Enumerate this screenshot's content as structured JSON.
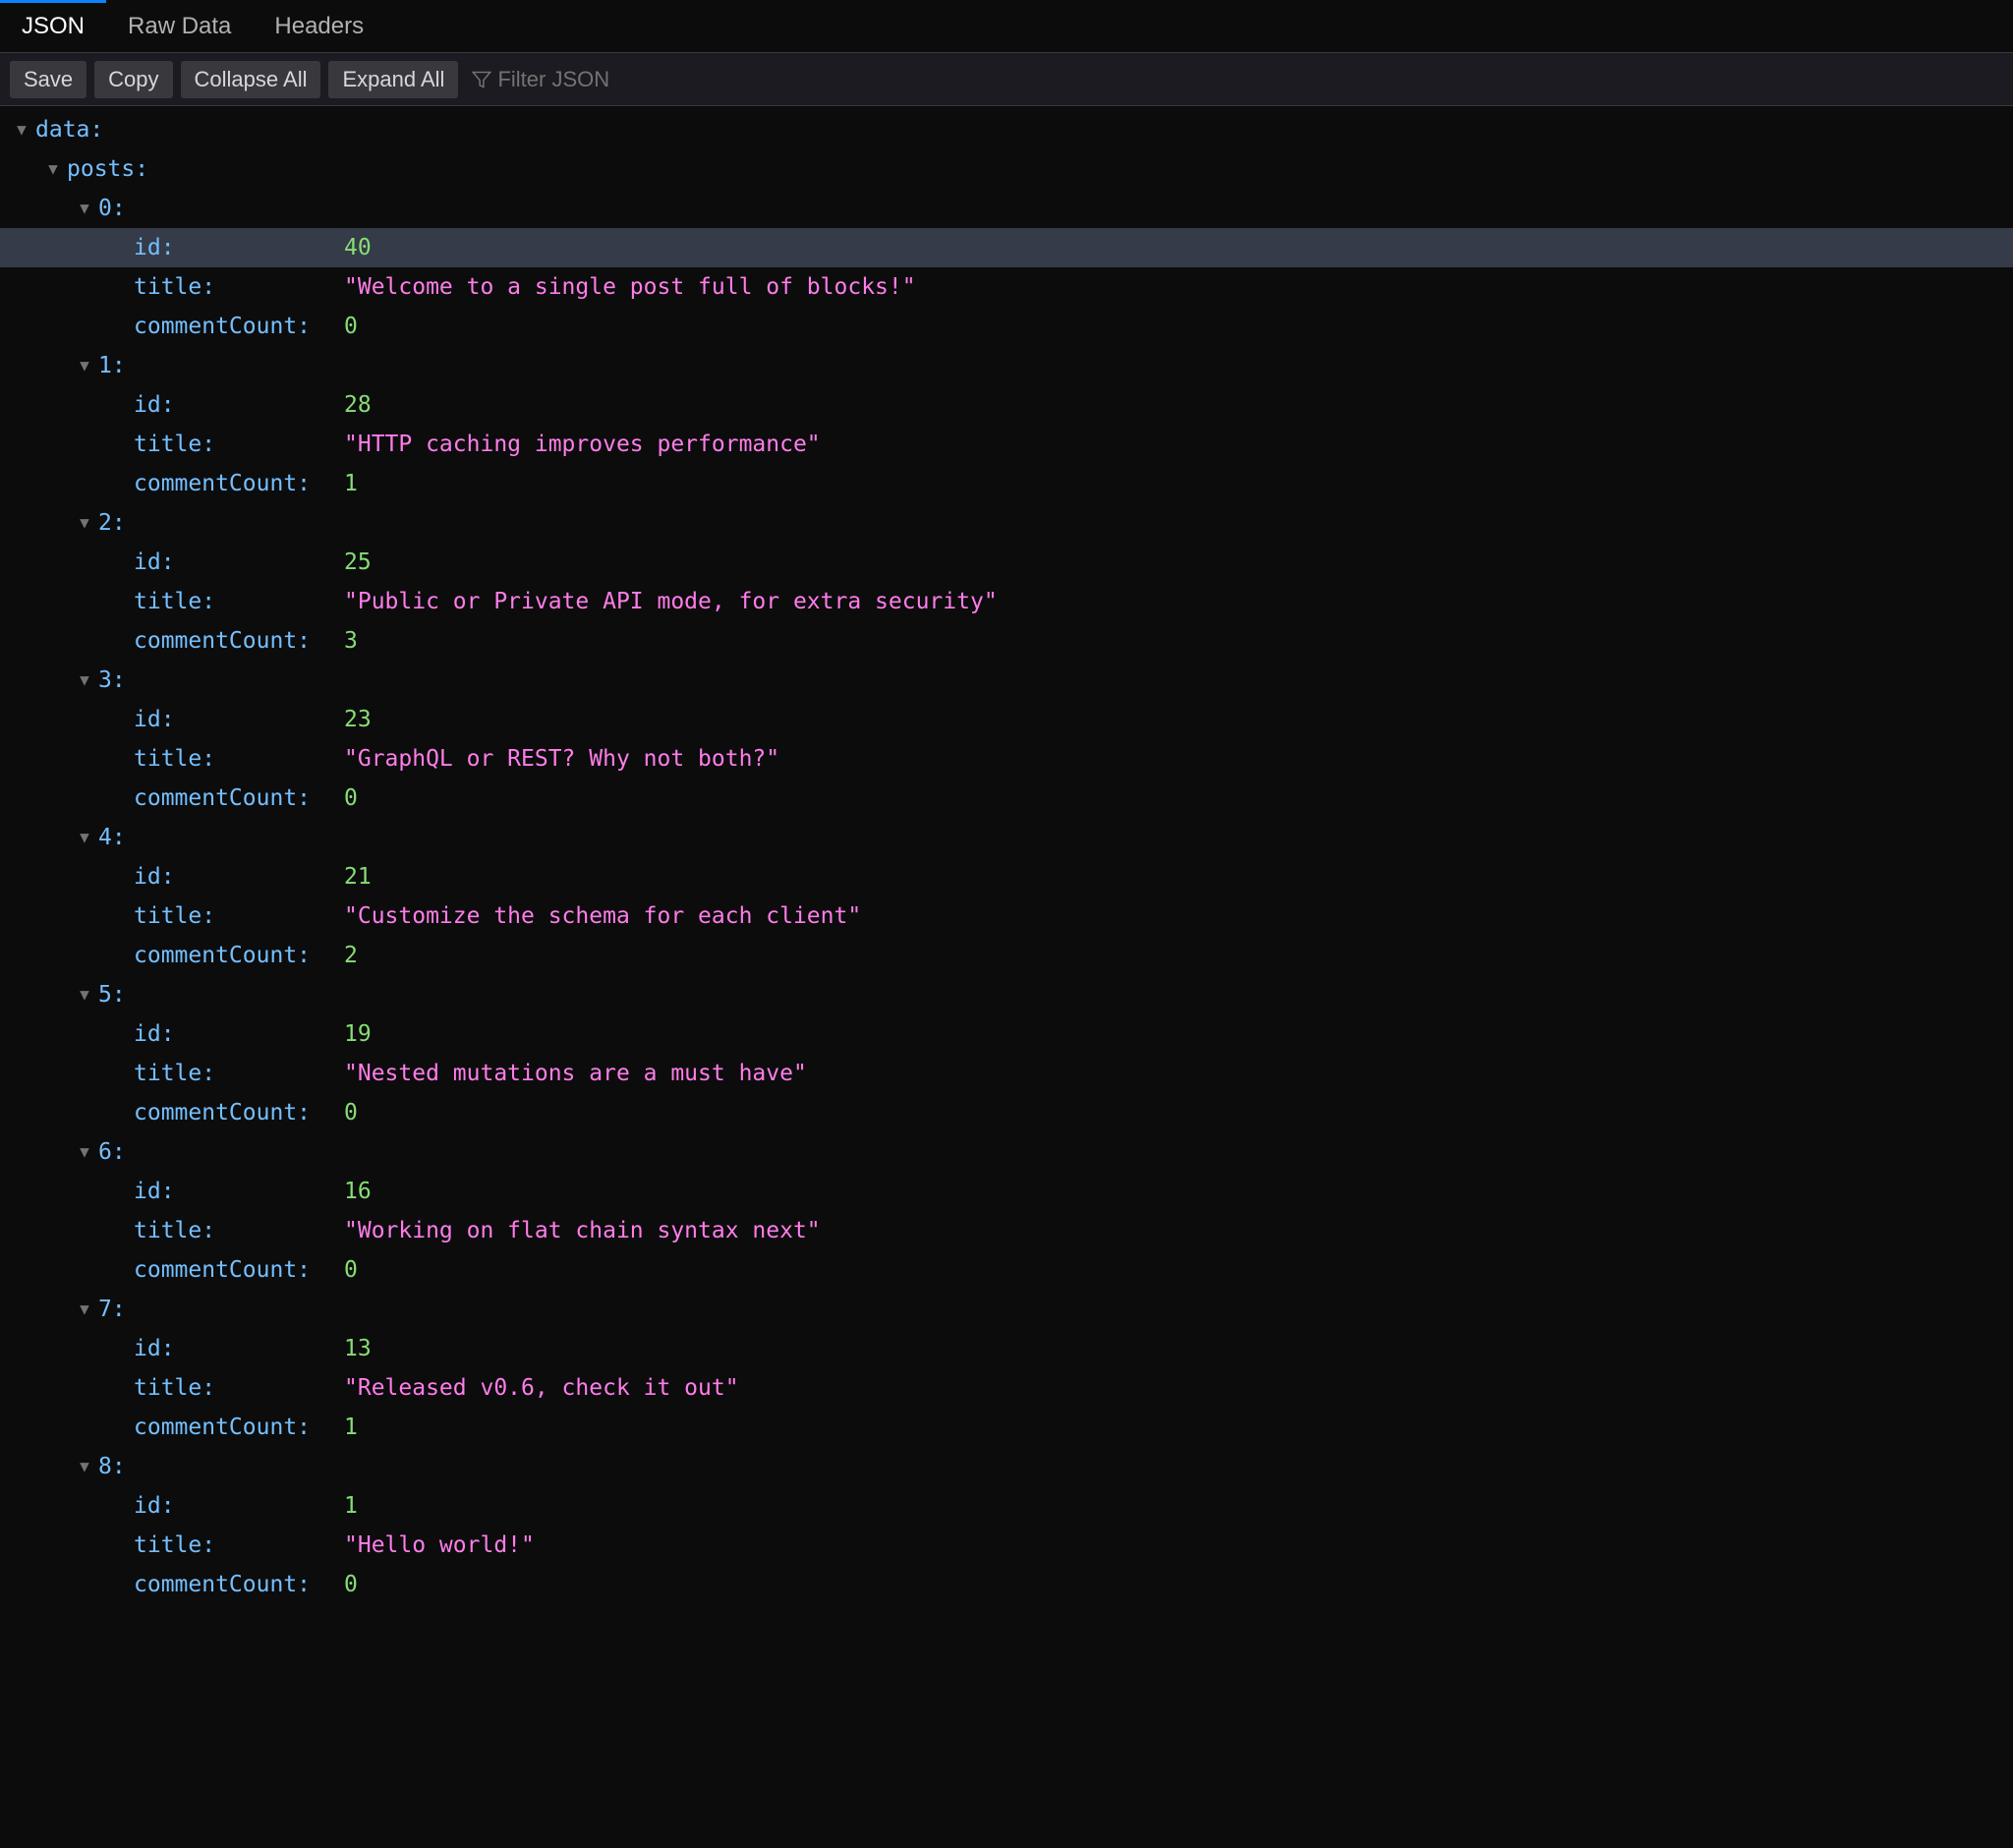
{
  "tabs": {
    "json": "JSON",
    "raw": "Raw Data",
    "headers": "Headers"
  },
  "toolbar": {
    "save": "Save",
    "copy": "Copy",
    "collapse": "Collapse All",
    "expand": "Expand All",
    "filter_placeholder": "Filter JSON"
  },
  "tree": {
    "root_key": "data:",
    "posts_key": "posts:",
    "field_id": "id:",
    "field_title": "title:",
    "field_commentCount": "commentCount:",
    "items": [
      {
        "index": "0:",
        "id": "40",
        "title": "\"Welcome to a single post full of blocks!\"",
        "commentCount": "0",
        "highlight_id": true
      },
      {
        "index": "1:",
        "id": "28",
        "title": "\"HTTP caching improves performance\"",
        "commentCount": "1"
      },
      {
        "index": "2:",
        "id": "25",
        "title": "\"Public or Private API mode, for extra security\"",
        "commentCount": "3"
      },
      {
        "index": "3:",
        "id": "23",
        "title": "\"GraphQL or REST? Why not both?\"",
        "commentCount": "0"
      },
      {
        "index": "4:",
        "id": "21",
        "title": "\"Customize the schema for each client\"",
        "commentCount": "2"
      },
      {
        "index": "5:",
        "id": "19",
        "title": "\"Nested mutations are a must have\"",
        "commentCount": "0"
      },
      {
        "index": "6:",
        "id": "16",
        "title": "\"Working on flat chain syntax next\"",
        "commentCount": "0"
      },
      {
        "index": "7:",
        "id": "13",
        "title": "\"Released v0.6, check it out\"",
        "commentCount": "1"
      },
      {
        "index": "8:",
        "id": "1",
        "title": "\"Hello world!\"",
        "commentCount": "0"
      }
    ]
  }
}
